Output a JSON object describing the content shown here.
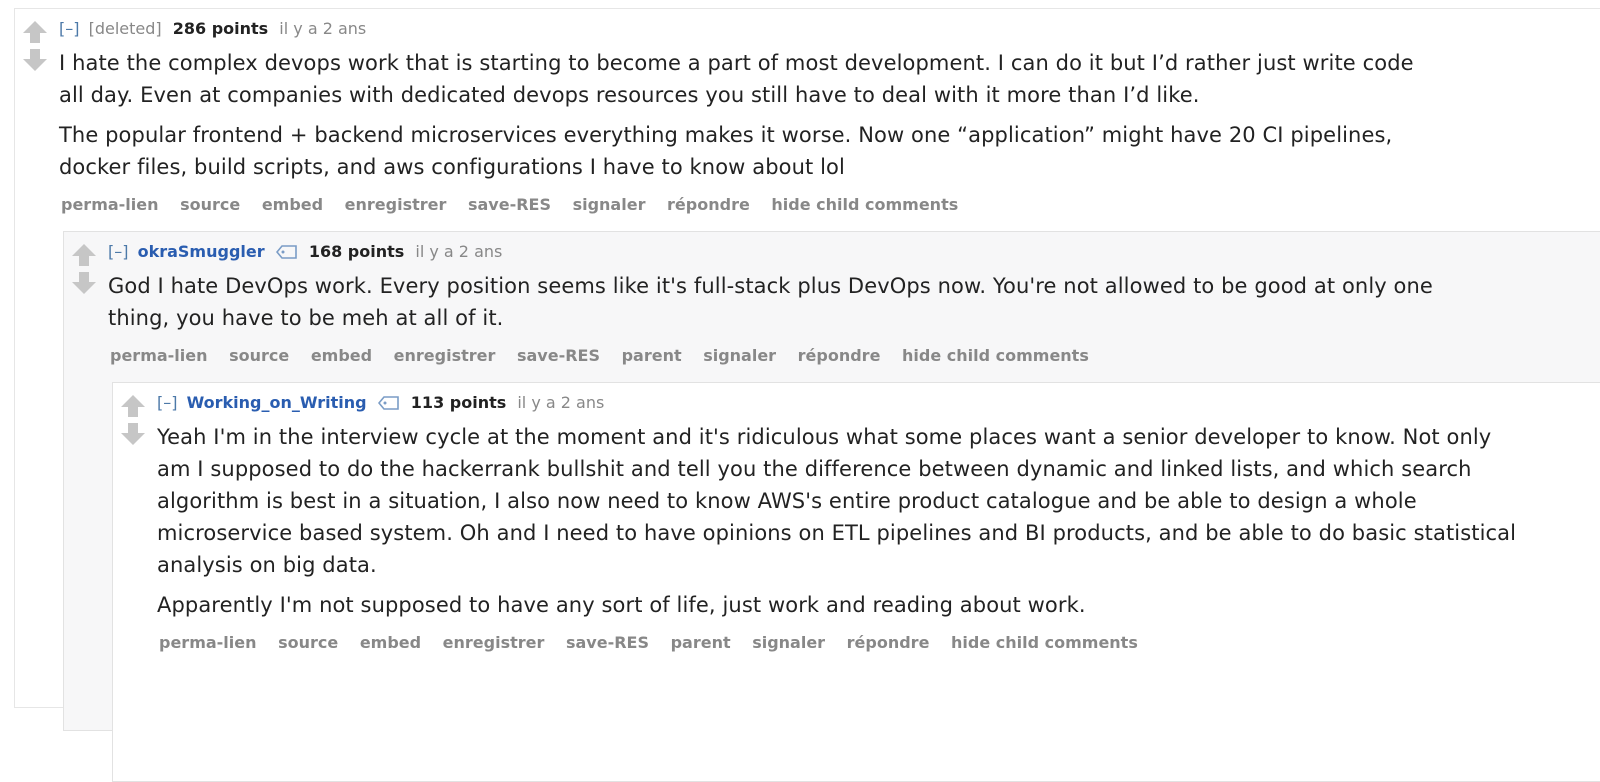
{
  "comments": [
    {
      "expand": "[–]",
      "author": "[deleted]",
      "score": "286 points",
      "time": "il y a 2 ans",
      "paragraphs": [
        "I hate the complex devops work that is starting to become a part of most development. I can do it but I’d rather just write code all day. Even at companies with dedicated devops resources you still have to deal with it more than I’d like.",
        "The popular frontend + backend microservices everything makes it worse. Now one “application” might have 20 CI pipelines, docker files, build scripts, and aws configurations I have to know about lol"
      ],
      "buttons": [
        "perma-lien",
        "source",
        "embed",
        "enregistrer",
        "save-RES",
        "signaler",
        "répondre",
        "hide child comments"
      ]
    },
    {
      "expand": "[–]",
      "author": "okraSmuggler",
      "score": "168 points",
      "time": "il y a 2 ans",
      "paragraphs": [
        "God I hate DevOps work. Every position seems like it's full-stack plus DevOps now. You're not allowed to be good at only one thing, you have to be meh at all of it."
      ],
      "buttons": [
        "perma-lien",
        "source",
        "embed",
        "enregistrer",
        "save-RES",
        "parent",
        "signaler",
        "répondre",
        "hide child comments"
      ]
    },
    {
      "expand": "[–]",
      "author": "Working_on_Writing",
      "score": "113 points",
      "time": "il y a 2 ans",
      "paragraphs": [
        "Yeah I'm in the interview cycle at the moment and it's ridiculous what some places want a senior developer to know. Not only am I supposed to do the hackerrank bullshit and tell you the difference between dynamic and linked lists, and which search algorithm is best in a situation, I also now need to know AWS's entire product catalogue and be able to design a whole microservice based system. Oh and I need to have opinions on ETL pipelines and BI products, and be able to do basic statistical analysis on big data.",
        "Apparently I'm not supposed to have any sort of life, just work and reading about work."
      ],
      "buttons": [
        "perma-lien",
        "source",
        "embed",
        "enregistrer",
        "save-RES",
        "parent",
        "signaler",
        "répondre",
        "hide child comments"
      ]
    }
  ],
  "colors": {
    "author": "#2a5db0",
    "expand": "#4c79a8",
    "meta": "#888888",
    "vote_arrow": "#c6c6c6",
    "nested_bg": "#f7f7f8"
  },
  "icons": {
    "upvote": "upvote-arrow-icon",
    "downvote": "downvote-arrow-icon",
    "tag": "user-tag-icon"
  }
}
